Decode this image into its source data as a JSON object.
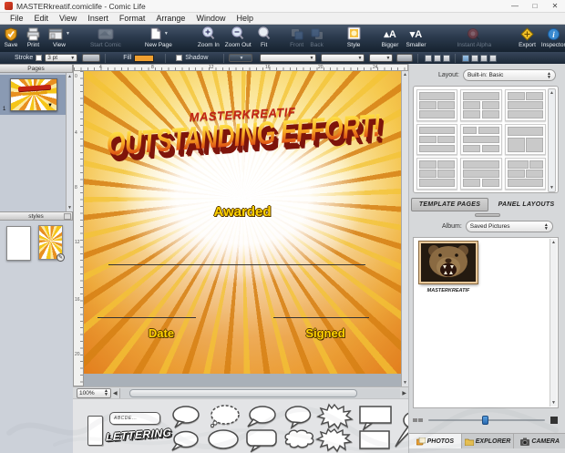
{
  "window": {
    "title": "MASTERkreatif.comiclife - Comic Life",
    "controls": {
      "minimize": "—",
      "maximize": "□",
      "close": "✕"
    }
  },
  "menu": {
    "items": [
      "File",
      "Edit",
      "View",
      "Insert",
      "Format",
      "Arrange",
      "Window",
      "Help"
    ]
  },
  "toolbar": {
    "buttons": [
      {
        "label": "Save",
        "enabled": true
      },
      {
        "label": "Print",
        "enabled": true
      },
      {
        "label": "View",
        "enabled": true
      },
      {
        "label": "Start Comic",
        "enabled": false
      },
      {
        "label": "New Page",
        "enabled": true
      },
      {
        "label": "Zoom In",
        "enabled": true
      },
      {
        "label": "Zoom Out",
        "enabled": true
      },
      {
        "label": "Fit",
        "enabled": true
      },
      {
        "label": "Front",
        "enabled": false
      },
      {
        "label": "Back",
        "enabled": false
      },
      {
        "label": "Style",
        "enabled": true
      },
      {
        "label": "Bigger",
        "enabled": true
      },
      {
        "label": "Smaller",
        "enabled": true
      },
      {
        "label": "Instant Alpha",
        "enabled": false
      },
      {
        "label": "Export",
        "enabled": true
      },
      {
        "label": "Inspector",
        "enabled": true
      }
    ],
    "overflow_chevron": "»",
    "bigger_glyph": "▴A",
    "smaller_glyph": "▾A"
  },
  "format_bar": {
    "stroke_label": "Stroke",
    "stroke_width_value": "3 pt",
    "fill_label": "Fill",
    "fill_color": "#f0a030",
    "shadow_label": "Shadow"
  },
  "pages_panel": {
    "header": "Pages",
    "page_number": "1"
  },
  "styles_panel": {
    "header": "styles"
  },
  "canvas": {
    "h_ruler": [
      "4",
      "8",
      "12",
      "16",
      "20",
      "24"
    ],
    "v_ruler": [
      "0",
      "4",
      "8",
      "12",
      "16",
      "20"
    ],
    "zoom_level": "100%",
    "certificate": {
      "brand": "MASTERKREATIF",
      "title": "OUTSTANDING EFFORT!",
      "awarded_label": "Awarded",
      "date_label": "Date",
      "signed_label": "Signed"
    }
  },
  "lettering_palette": {
    "abc_sample": "ABCDE...",
    "lettering_label": "LETTERING",
    "balloon_shapes": [
      "speech-oval",
      "thought-oval-dotted",
      "speech-oval-left-tail",
      "speech-oval-small-tail",
      "burst-balloon",
      "rect-balloon",
      "speech-oval-long-tail",
      "speech-oval-low",
      "wide-oval",
      "roundrect-balloon",
      "cloud-balloon",
      "burst-balloon-2",
      "rect-balloon-plain"
    ]
  },
  "right_panel": {
    "layout_label": "Layout:",
    "layout_value": "Built-in: Basic",
    "tabs": {
      "template_pages": "TEMPLATE PAGES",
      "panel_layouts": "PANEL LAYOUTS"
    },
    "album_label": "Album:",
    "album_value": "Saved Pictures",
    "photo_caption": "MASTERKREATIF",
    "media_tabs": {
      "photos": "PHOTOS",
      "explorer": "EXPLORER",
      "camera": "CAMERA"
    }
  }
}
